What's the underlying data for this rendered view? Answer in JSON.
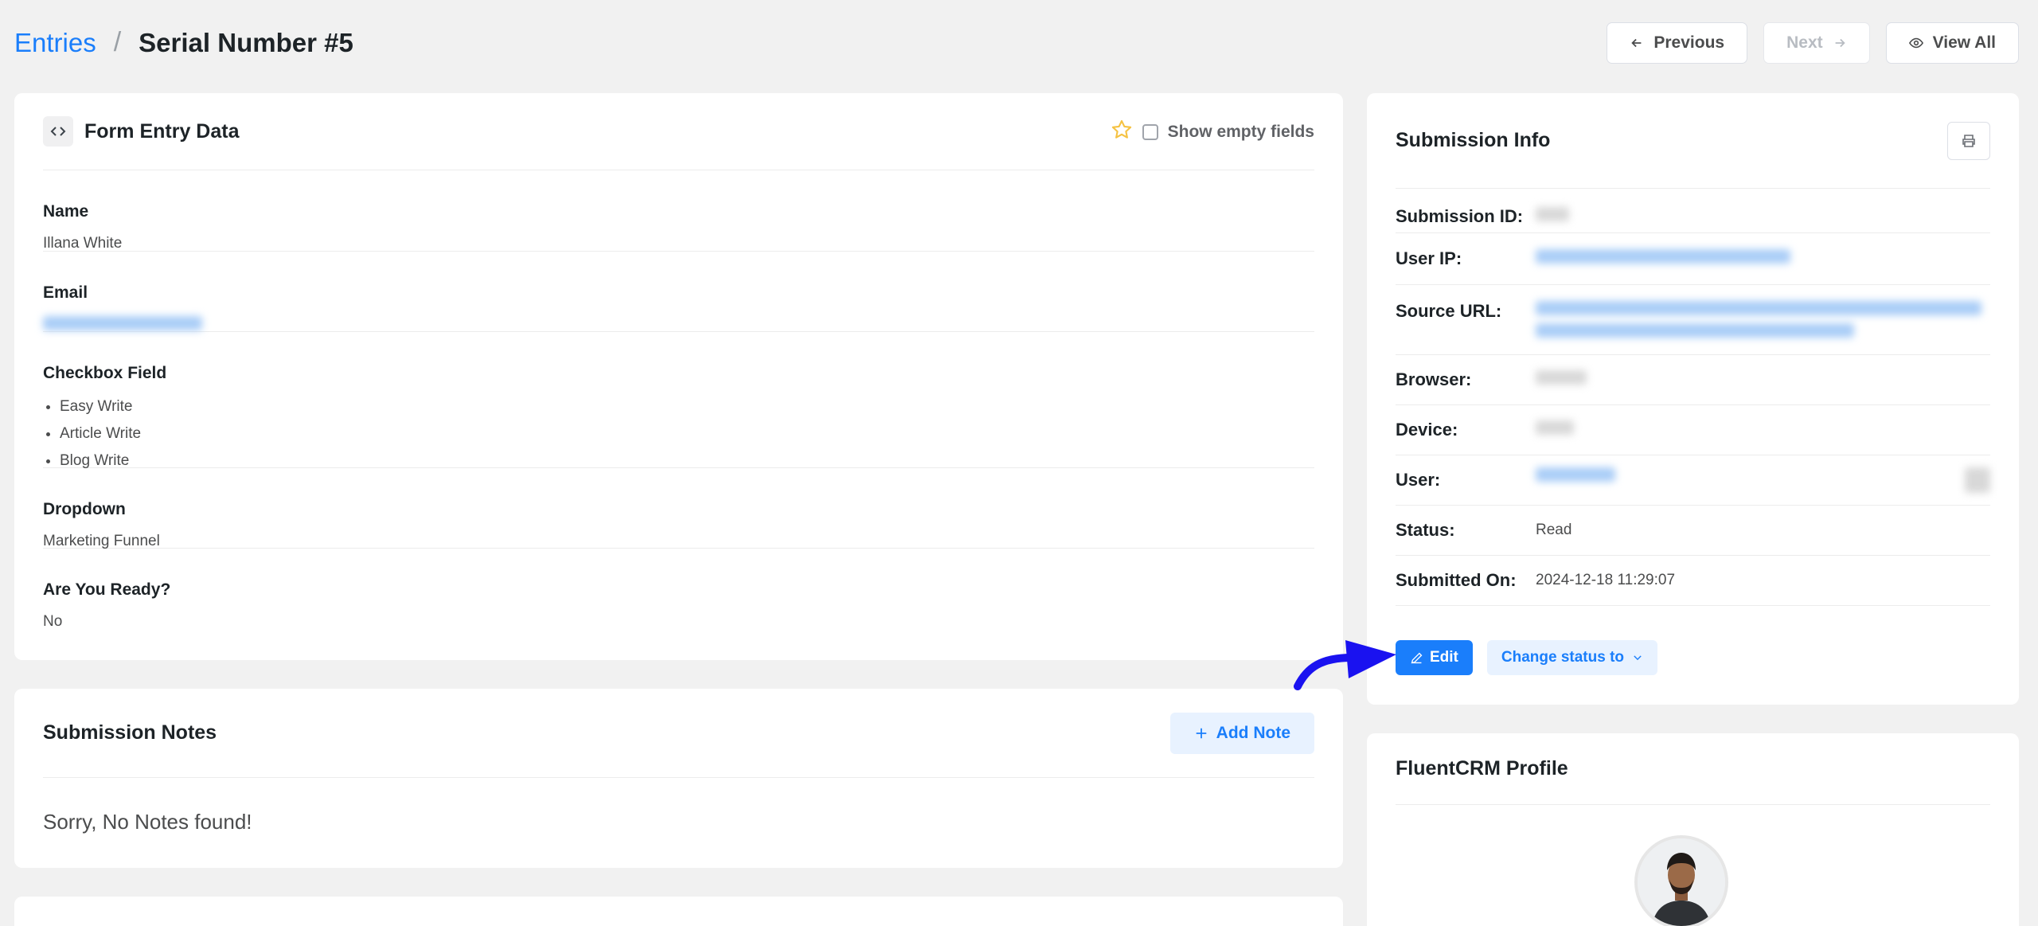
{
  "breadcrumb": {
    "parent": "Entries",
    "separator": "/",
    "current": "Serial Number #5"
  },
  "nav": {
    "previous": "Previous",
    "next": "Next",
    "view_all": "View All"
  },
  "entry": {
    "title": "Form Entry Data",
    "show_empty": "Show empty fields",
    "fields": [
      {
        "label": "Name",
        "value": "Illana White"
      },
      {
        "label": "Email"
      },
      {
        "label": "Checkbox Field",
        "items": [
          "Easy Write",
          "Article Write",
          "Blog Write"
        ]
      },
      {
        "label": "Dropdown",
        "value": "Marketing Funnel"
      },
      {
        "label": "Are You Ready?",
        "value": "No"
      }
    ]
  },
  "notes": {
    "title": "Submission Notes",
    "add_label": "Add Note",
    "empty": "Sorry, No Notes found!"
  },
  "submission": {
    "title": "Submission Info",
    "rows": [
      {
        "label": "Submission ID:"
      },
      {
        "label": "User IP:"
      },
      {
        "label": "Source URL:"
      },
      {
        "label": "Browser:"
      },
      {
        "label": "Device:"
      },
      {
        "label": "User:"
      },
      {
        "label": "Status:",
        "value": "Read"
      },
      {
        "label": "Submitted On:",
        "value": "2024-12-18 11:29:07"
      }
    ],
    "edit_label": "Edit",
    "status_label": "Change status to"
  },
  "crm": {
    "title": "FluentCRM Profile"
  },
  "colors": {
    "accent": "#1a7efb",
    "annotation_arrow": "#1a12f0",
    "star": "#f5c242"
  },
  "icons": [
    "arrow-left-icon",
    "arrow-right-icon",
    "eye-icon",
    "code-icon",
    "star-icon",
    "checkbox",
    "print-icon",
    "pencil-icon",
    "plus-icon",
    "chevron-down-icon"
  ]
}
